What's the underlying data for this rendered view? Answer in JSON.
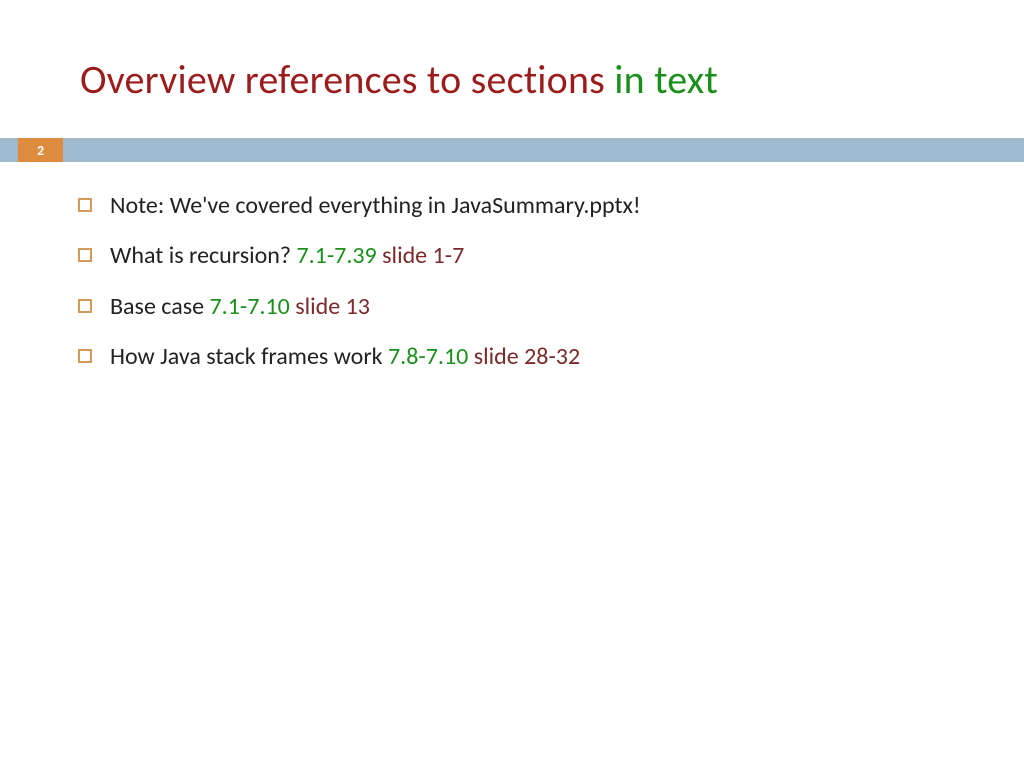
{
  "slide": {
    "page_number": "2",
    "title": {
      "red_part": "Overview references to sections ",
      "green_part": "in text"
    },
    "bullets": [
      {
        "segments": [
          {
            "text": "Note: We've covered everything in JavaSummary.pptx!",
            "color": "c-black"
          }
        ]
      },
      {
        "segments": [
          {
            "text": "What is recursion? ",
            "color": "c-black"
          },
          {
            "text": "7.1-7.39",
            "color": "c-green"
          },
          {
            "text": "   ",
            "color": "c-black"
          },
          {
            "text": "slide 1-7",
            "color": "c-dkred"
          }
        ]
      },
      {
        "segments": [
          {
            "text": "Base case   ",
            "color": "c-black"
          },
          {
            "text": "7.1-7.10 ",
            "color": "c-green"
          },
          {
            "text": "slide 13",
            "color": "c-dkred"
          }
        ]
      },
      {
        "segments": [
          {
            "text": "How Java stack frames work ",
            "color": "c-black"
          },
          {
            "text": "7.8-7.10 ",
            "color": "c-green"
          },
          {
            "text": "slide 28-32",
            "color": "c-dkred"
          }
        ]
      }
    ]
  }
}
